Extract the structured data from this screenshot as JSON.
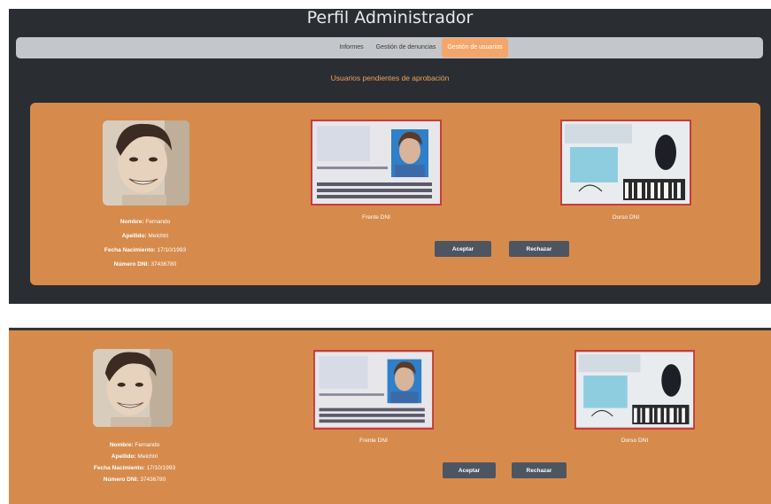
{
  "header": {
    "title": "Perfil Administrador"
  },
  "nav": {
    "items": [
      {
        "label": "Informes",
        "active": false
      },
      {
        "label": "Gestión de denuncias",
        "active": false
      },
      {
        "label": "Gestión de usuarios",
        "active": true
      }
    ]
  },
  "section": {
    "heading": "Usuarios pendientes de aprobación"
  },
  "user": {
    "nombre_label": "Nombre:",
    "nombre": "Fernando",
    "apellido_label": "Apellido:",
    "apellido": "Melchtri",
    "fecha_label": "Fecha Nacimiento:",
    "fecha": "17/10/1993",
    "dni_label": "Número DNI:",
    "dni": "37436780"
  },
  "documents": {
    "front_caption": "Frente DNI",
    "back_caption": "Dorso DNI"
  },
  "actions": {
    "accept_label": "Aceptar",
    "reject_label": "Rechazar"
  },
  "colors": {
    "card_bg": "#d68b4c",
    "dark_bg": "#2a2d32",
    "accent": "#f4a66a",
    "button_bg": "#4d5561"
  }
}
